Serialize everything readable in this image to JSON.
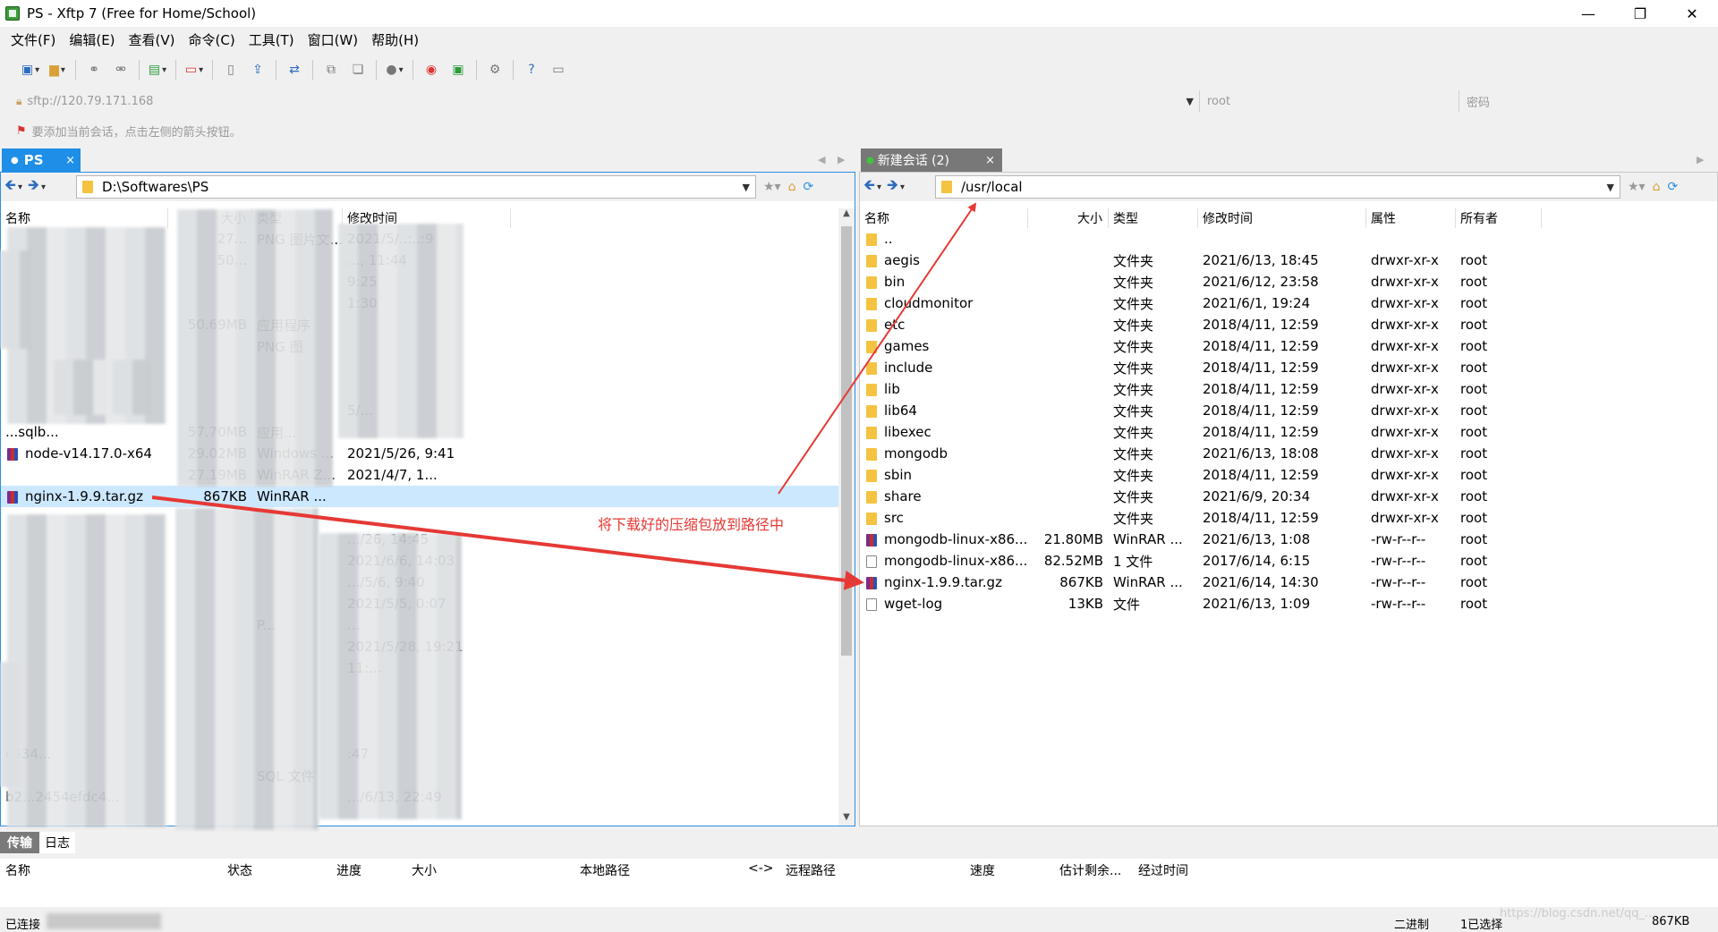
{
  "window": {
    "title": "PS - Xftp 7 (Free for Home/School)",
    "minimize": "—",
    "maximize": "❐",
    "close": "✕"
  },
  "menu": [
    "文件(F)",
    "编辑(E)",
    "查看(V)",
    "命令(C)",
    "工具(T)",
    "窗口(W)",
    "帮助(H)"
  ],
  "address": {
    "host": "sftp://120.79.171.168",
    "user": "root",
    "password_placeholder": "密码"
  },
  "hint": "要添加当前会话，点击左侧的箭头按钮。",
  "left_tab": {
    "label": "PS",
    "close": "×"
  },
  "right_tab": {
    "label": "新建会话 (2)",
    "close": "×"
  },
  "left": {
    "path": "D:\\Softwares\\PS",
    "columns": [
      "名称",
      "大小",
      "类型",
      "修改时间"
    ],
    "rows": [
      {
        "name": "",
        "size": "27...",
        "type": "PNG 图片文...",
        "date": "2021/5/..:..:9"
      },
      {
        "name": "",
        "size": "50...",
        "type": "",
        "date": "..., 11:44"
      },
      {
        "name": "",
        "size": "",
        "type": "",
        "date": "9:25"
      },
      {
        "name": "",
        "size": "",
        "type": "",
        "date": "1:30"
      },
      {
        "name": "",
        "size": "50.69MB",
        "type": "应用程序",
        "date": ""
      },
      {
        "name": "",
        "size": "",
        "type": "PNG 图",
        "date": ""
      },
      {
        "name": "",
        "size": "",
        "type": "",
        "date": ""
      },
      {
        "name": "",
        "size": "",
        "type": "",
        "date": ""
      },
      {
        "name": "",
        "size": "",
        "type": "",
        "date": "5/..."
      },
      {
        "name": "...sqlb...",
        "size": "57.70MB",
        "type": "应用...",
        "date": ""
      },
      {
        "name": "node-v14.17.0-x64",
        "size": "29.02MB",
        "type": "Windows ...",
        "date": "2021/5/26, 9:41"
      },
      {
        "name": "",
        "size": "27.19MB",
        "type": "WinRAR Z...",
        "date": "2021/4/7, 1..."
      },
      {
        "name": "nginx-1.9.9.tar.gz",
        "size": "867KB",
        "type": "WinRAR ...",
        "date": ""
      },
      {
        "name": "",
        "size": "",
        "type": "",
        "date": ""
      },
      {
        "name": "",
        "size": "",
        "type": "",
        "date": ".../26, 14:45"
      },
      {
        "name": "",
        "size": "",
        "type": "",
        "date": "2021/6/6, 14:03"
      },
      {
        "name": "",
        "size": "",
        "type": "",
        "date": ".../5/6, 9:40"
      },
      {
        "name": "",
        "size": "",
        "type": "",
        "date": "2021/5/5, 0:07"
      },
      {
        "name": "",
        "size": "",
        "type": "P...",
        "date": "..."
      },
      {
        "name": "",
        "size": "",
        "type": "",
        "date": "2021/5/28, 19:21"
      },
      {
        "name": "",
        "size": "",
        "type": "",
        "date": "11:..."
      },
      {
        "name": "",
        "size": "",
        "type": "",
        "date": ""
      },
      {
        "name": "",
        "size": "",
        "type": "",
        "date": ""
      },
      {
        "name": "",
        "size": "",
        "type": "",
        "date": ""
      },
      {
        "name": "c534...",
        "size": "",
        "type": "",
        "date": ":47"
      },
      {
        "name": "",
        "size": "",
        "type": "SQL 文件",
        "date": ""
      },
      {
        "name": "b2...2454efdc4...",
        "size": "",
        "type": "",
        "date": ".../6/13, 22:49"
      }
    ]
  },
  "right": {
    "path": "/usr/local",
    "columns": [
      "名称",
      "大小",
      "类型",
      "修改时间",
      "属性",
      "所有者"
    ],
    "rows": [
      {
        "name": "..",
        "icon": "folder",
        "size": "",
        "type": "",
        "date": "",
        "attr": "",
        "owner": ""
      },
      {
        "name": "aegis",
        "icon": "folder",
        "size": "",
        "type": "文件夹",
        "date": "2021/6/13, 18:45",
        "attr": "drwxr-xr-x",
        "owner": "root"
      },
      {
        "name": "bin",
        "icon": "folder",
        "size": "",
        "type": "文件夹",
        "date": "2021/6/12, 23:58",
        "attr": "drwxr-xr-x",
        "owner": "root"
      },
      {
        "name": "cloudmonitor",
        "icon": "folder",
        "size": "",
        "type": "文件夹",
        "date": "2021/6/1, 19:24",
        "attr": "drwxr-xr-x",
        "owner": "root"
      },
      {
        "name": "etc",
        "icon": "folder",
        "size": "",
        "type": "文件夹",
        "date": "2018/4/11, 12:59",
        "attr": "drwxr-xr-x",
        "owner": "root"
      },
      {
        "name": "games",
        "icon": "folder",
        "size": "",
        "type": "文件夹",
        "date": "2018/4/11, 12:59",
        "attr": "drwxr-xr-x",
        "owner": "root"
      },
      {
        "name": "include",
        "icon": "folder",
        "size": "",
        "type": "文件夹",
        "date": "2018/4/11, 12:59",
        "attr": "drwxr-xr-x",
        "owner": "root"
      },
      {
        "name": "lib",
        "icon": "folder",
        "size": "",
        "type": "文件夹",
        "date": "2018/4/11, 12:59",
        "attr": "drwxr-xr-x",
        "owner": "root"
      },
      {
        "name": "lib64",
        "icon": "folder",
        "size": "",
        "type": "文件夹",
        "date": "2018/4/11, 12:59",
        "attr": "drwxr-xr-x",
        "owner": "root"
      },
      {
        "name": "libexec",
        "icon": "folder",
        "size": "",
        "type": "文件夹",
        "date": "2018/4/11, 12:59",
        "attr": "drwxr-xr-x",
        "owner": "root"
      },
      {
        "name": "mongodb",
        "icon": "folder",
        "size": "",
        "type": "文件夹",
        "date": "2021/6/13, 18:08",
        "attr": "drwxr-xr-x",
        "owner": "root"
      },
      {
        "name": "sbin",
        "icon": "folder",
        "size": "",
        "type": "文件夹",
        "date": "2018/4/11, 12:59",
        "attr": "drwxr-xr-x",
        "owner": "root"
      },
      {
        "name": "share",
        "icon": "folder",
        "size": "",
        "type": "文件夹",
        "date": "2021/6/9, 20:34",
        "attr": "drwxr-xr-x",
        "owner": "root"
      },
      {
        "name": "src",
        "icon": "folder",
        "size": "",
        "type": "文件夹",
        "date": "2018/4/11, 12:59",
        "attr": "drwxr-xr-x",
        "owner": "root"
      },
      {
        "name": "mongodb-linux-x86...",
        "icon": "rar",
        "size": "21.80MB",
        "type": "WinRAR ...",
        "date": "2021/6/13, 1:08",
        "attr": "-rw-r--r--",
        "owner": "root"
      },
      {
        "name": "mongodb-linux-x86...",
        "icon": "doc",
        "size": "82.52MB",
        "type": "1 文件",
        "date": "2017/6/14, 6:15",
        "attr": "-rw-r--r--",
        "owner": "root"
      },
      {
        "name": "nginx-1.9.9.tar.gz",
        "icon": "rar",
        "size": "867KB",
        "type": "WinRAR ...",
        "date": "2021/6/14, 14:30",
        "attr": "-rw-r--r--",
        "owner": "root"
      },
      {
        "name": "wget-log",
        "icon": "doc",
        "size": "13KB",
        "type": "文件",
        "date": "2021/6/13, 1:09",
        "attr": "-rw-r--r--",
        "owner": "root"
      }
    ]
  },
  "annotation": "将下载好的压缩包放到路径中",
  "log_tabs": {
    "transfer": "传输",
    "log": "日志"
  },
  "transfer_columns": [
    "名称",
    "状态",
    "进度",
    "大小",
    "本地路径",
    "<->",
    "远程路径",
    "速度",
    "估计剩余...",
    "经过时间"
  ],
  "status": {
    "connected": "已连接",
    "mode": "二进制",
    "selected": "1已选择",
    "size": "867KB"
  },
  "watermark": "https://blog.csdn.net/qq_..."
}
